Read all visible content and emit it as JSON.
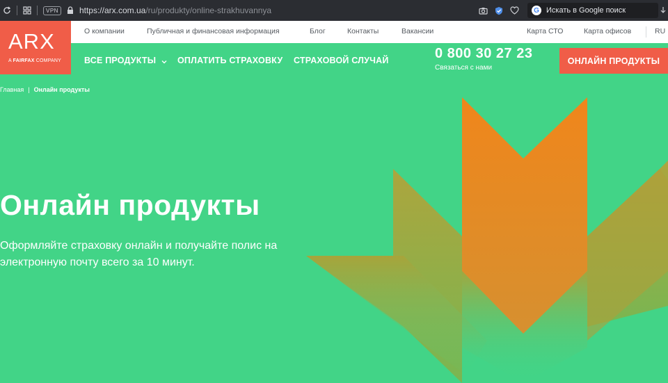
{
  "browser": {
    "url_main": "https://arx.com.ua",
    "url_path": "/ru/produkty/online-strakhuvannya",
    "vpn_label": "VPN",
    "search_placeholder": "Искать в Google поиск",
    "search_engine_letter": "G"
  },
  "logo": {
    "text": "ARX",
    "sub_a": "A",
    "sub_brand": "FAIRFAX",
    "sub_company": "COMPANY"
  },
  "top_nav": {
    "items": [
      "О компании",
      "Публичная и финансовая информация",
      "Блог",
      "Контакты",
      "Вакансии"
    ],
    "right_items": [
      "Карта СТО",
      "Карта офисов"
    ],
    "lang": "RU"
  },
  "main_nav": {
    "all_products": "ВСЕ ПРОДУКТЫ",
    "pay": "ОПЛАТИТЬ СТРАХОВКУ",
    "claim": "СТРАХОВОЙ СЛУЧАЙ"
  },
  "contact": {
    "phone": "0 800 30 27 23",
    "phone_sub": "Связаться с нами"
  },
  "cta": {
    "label": "ОНЛАЙН ПРОДУКТЫ"
  },
  "breadcrumb": {
    "home": "Главная",
    "sep": "|",
    "current": "Онлайн продукты"
  },
  "hero": {
    "title": "Онлайн продукты",
    "text": "Оформляйте страховку онлайн и получайте полис на электронную почту всего за 10 минут."
  },
  "colors": {
    "background": "#42d487",
    "brand_red": "#f05d48",
    "browser_bar": "#2b2d32",
    "graphic_orange": "#f0861b"
  }
}
